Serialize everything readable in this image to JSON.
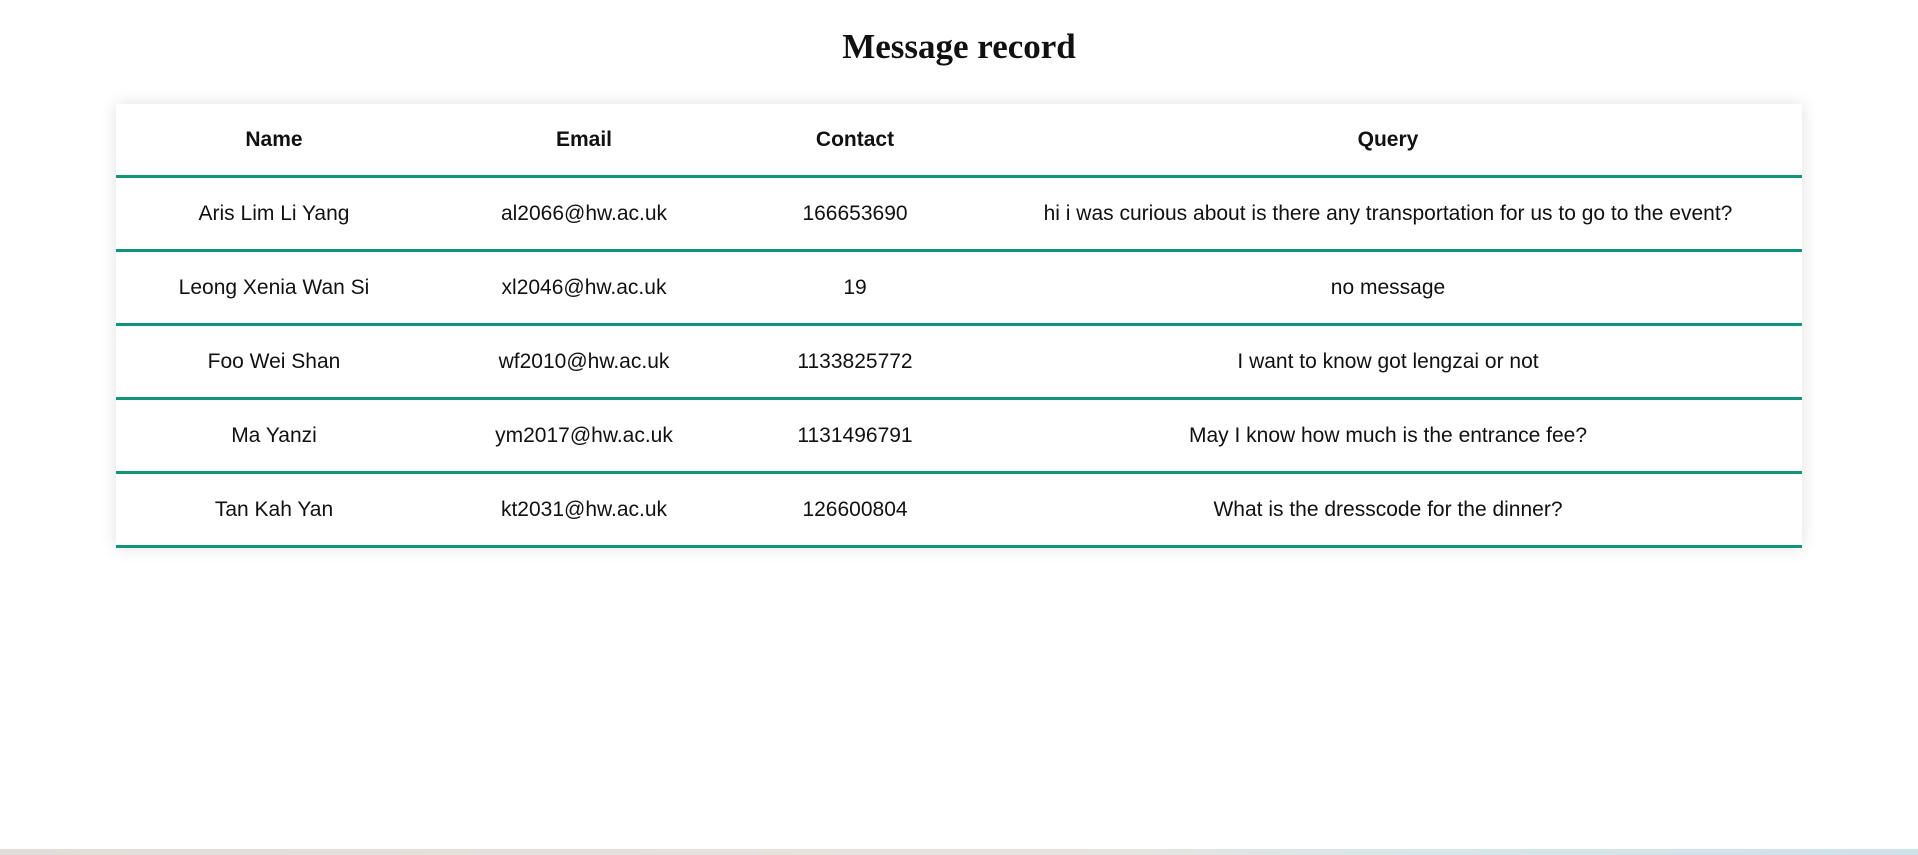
{
  "page": {
    "title": "Message record"
  },
  "table": {
    "headers": [
      "Name",
      "Email",
      "Contact",
      "Query"
    ],
    "rows": [
      [
        "Aris Lim Li Yang",
        "al2066@hw.ac.uk",
        "166653690",
        "hi i was curious about is there any transportation for us to go to the event?"
      ],
      [
        "Leong Xenia Wan Si",
        "xl2046@hw.ac.uk",
        "19",
        "no message"
      ],
      [
        "Foo Wei Shan",
        "wf2010@hw.ac.uk",
        "1133825772",
        "I want to know got lengzai or not"
      ],
      [
        "Ma Yanzi",
        "ym2017@hw.ac.uk",
        "1131496791",
        "May I know how much is the entrance fee?"
      ],
      [
        "Tan Kah Yan",
        "kt2031@hw.ac.uk",
        "126600804",
        "What is the dresscode for the dinner?"
      ]
    ]
  },
  "colors": {
    "row_border": "#11957a",
    "text": "#111111",
    "background": "#ffffff"
  }
}
